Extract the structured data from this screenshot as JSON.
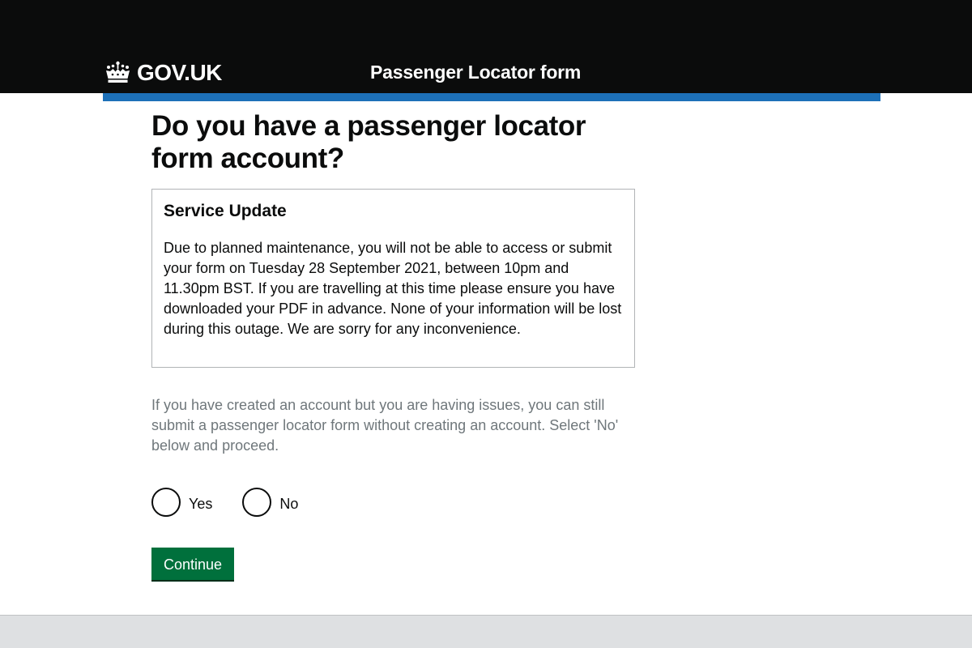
{
  "header": {
    "logo_text": "GOV.UK",
    "logo_icon": "crown-icon",
    "service_name": "Passenger Locator form"
  },
  "main": {
    "title": "Do you have a passenger locator form account?",
    "notice": {
      "heading": "Service Update",
      "body": "Due to planned maintenance, you will not be able to access or submit your form on Tuesday 28 September 2021, between 10pm and 11.30pm BST. If you are travelling at this time please ensure you have downloaded your PDF in advance. None of your information will be lost during this outage. We are sorry for any inconvenience."
    },
    "hint": "If you have created an account but you are having issues, you can still submit a passenger locator form without creating an account. Select 'No' below and proceed.",
    "options": [
      {
        "label": "Yes",
        "selected": false
      },
      {
        "label": "No",
        "selected": false
      }
    ],
    "continue_label": "Continue"
  },
  "colors": {
    "header_bg": "#0b0c0c",
    "accent_blue": "#1d70b8",
    "button_green": "#00703c",
    "hint_grey": "#6f777b",
    "footer_bg": "#dee0e2"
  }
}
